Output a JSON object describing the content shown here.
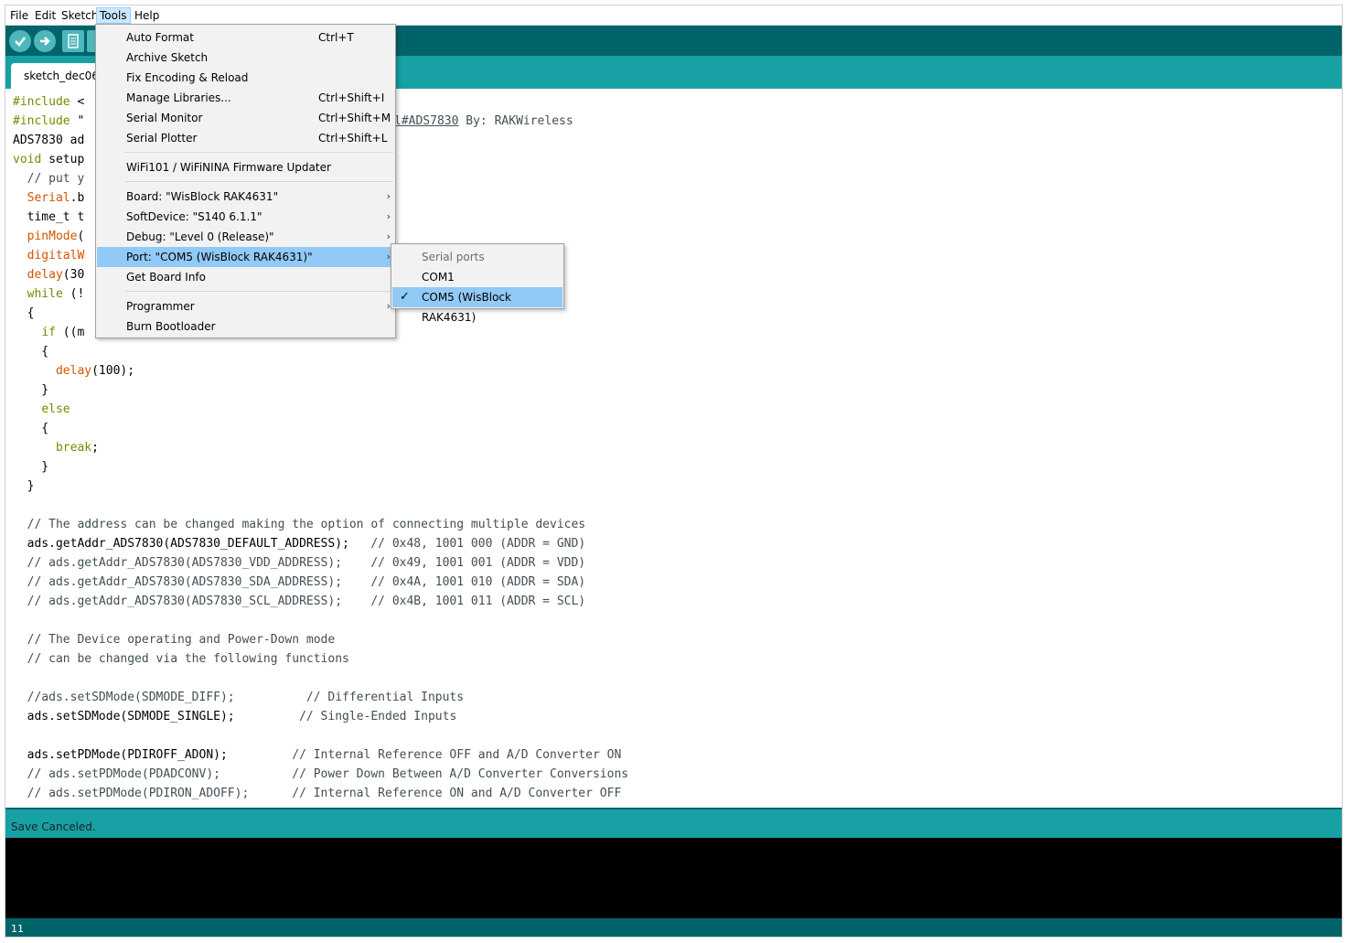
{
  "menubar": {
    "items": [
      "File",
      "Edit",
      "Sketch",
      "Tools",
      "Help"
    ]
  },
  "tab": {
    "label": "sketch_dec06a"
  },
  "editor": {
    "lines": [
      "#include <",
      "#include \"",
      "ADS7830 ad",
      "void setup",
      "  // put y",
      "  Serial.b",
      "  time_t t",
      "  pinMode(",
      "  digitalW",
      "  delay(30",
      "  while (!",
      "  {",
      "    if ((m",
      "    {",
      "      delay(100);",
      "    }",
      "    else",
      "    {",
      "      break;",
      "    }",
      "  }",
      "",
      "  // The address can be changed making the option of connecting multiple devices",
      "  ads.getAddr_ADS7830(ADS7830_DEFAULT_ADDRESS);   // 0x48, 1001 000 (ADDR = GND)",
      "  // ads.getAddr_ADS7830(ADS7830_VDD_ADDRESS);    // 0x49, 1001 001 (ADDR = VDD)",
      "  // ads.getAddr_ADS7830(ADS7830_SDA_ADDRESS);    // 0x4A, 1001 010 (ADDR = SDA)",
      "  // ads.getAddr_ADS7830(ADS7830_SCL_ADDRESS);    // 0x4B, 1001 011 (ADDR = SCL)",
      "",
      "  // The Device operating and Power-Down mode",
      "  // can be changed via the following functions",
      "",
      "  //ads.setSDMode(SDMODE_DIFF);          // Differential Inputs",
      "  ads.setSDMode(SDMODE_SINGLE);         // Single-Ended Inputs",
      "",
      "  ads.setPDMode(PDIROFF_ADON);         // Internal Reference OFF and A/D Converter ON",
      "  // ads.setPDMode(PDADCONV);          // Power Down Between A/D Converter Conversions",
      "  // ads.setPDMode(PDIRON_ADOFF);      // Internal Reference ON and A/D Converter OFF"
    ],
    "line2_tail": "l#ADS7830",
    "line2_after": " By: RAKWireless"
  },
  "tools_menu": {
    "items": [
      {
        "label": "Auto Format",
        "shortcut": "Ctrl+T"
      },
      {
        "label": "Archive Sketch",
        "shortcut": ""
      },
      {
        "label": "Fix Encoding & Reload",
        "shortcut": ""
      },
      {
        "label": "Manage Libraries...",
        "shortcut": "Ctrl+Shift+I"
      },
      {
        "label": "Serial Monitor",
        "shortcut": "Ctrl+Shift+M"
      },
      {
        "label": "Serial Plotter",
        "shortcut": "Ctrl+Shift+L"
      },
      {
        "label": "WiFi101 / WiFiNINA Firmware Updater",
        "shortcut": ""
      },
      {
        "label": "Board: \"WisBlock RAK4631\"",
        "shortcut": ""
      },
      {
        "label": "SoftDevice: \"S140 6.1.1\"",
        "shortcut": ""
      },
      {
        "label": "Debug: \"Level 0 (Release)\"",
        "shortcut": ""
      },
      {
        "label": "Port: \"COM5 (WisBlock RAK4631)\"",
        "shortcut": ""
      },
      {
        "label": "Get Board Info",
        "shortcut": ""
      },
      {
        "label": "Programmer",
        "shortcut": ""
      },
      {
        "label": "Burn Bootloader",
        "shortcut": ""
      }
    ]
  },
  "port_submenu": {
    "header": "Serial ports",
    "items": [
      "COM1",
      "COM5 (WisBlock RAK4631)"
    ],
    "selected": "COM5 (WisBlock RAK4631)"
  },
  "status": {
    "message": "Save Canceled."
  },
  "bottom": {
    "line_number": "11"
  },
  "colors": {
    "toolbar": "#006468",
    "tabbar": "#17a1a5",
    "highlight": "#91c9f7"
  }
}
